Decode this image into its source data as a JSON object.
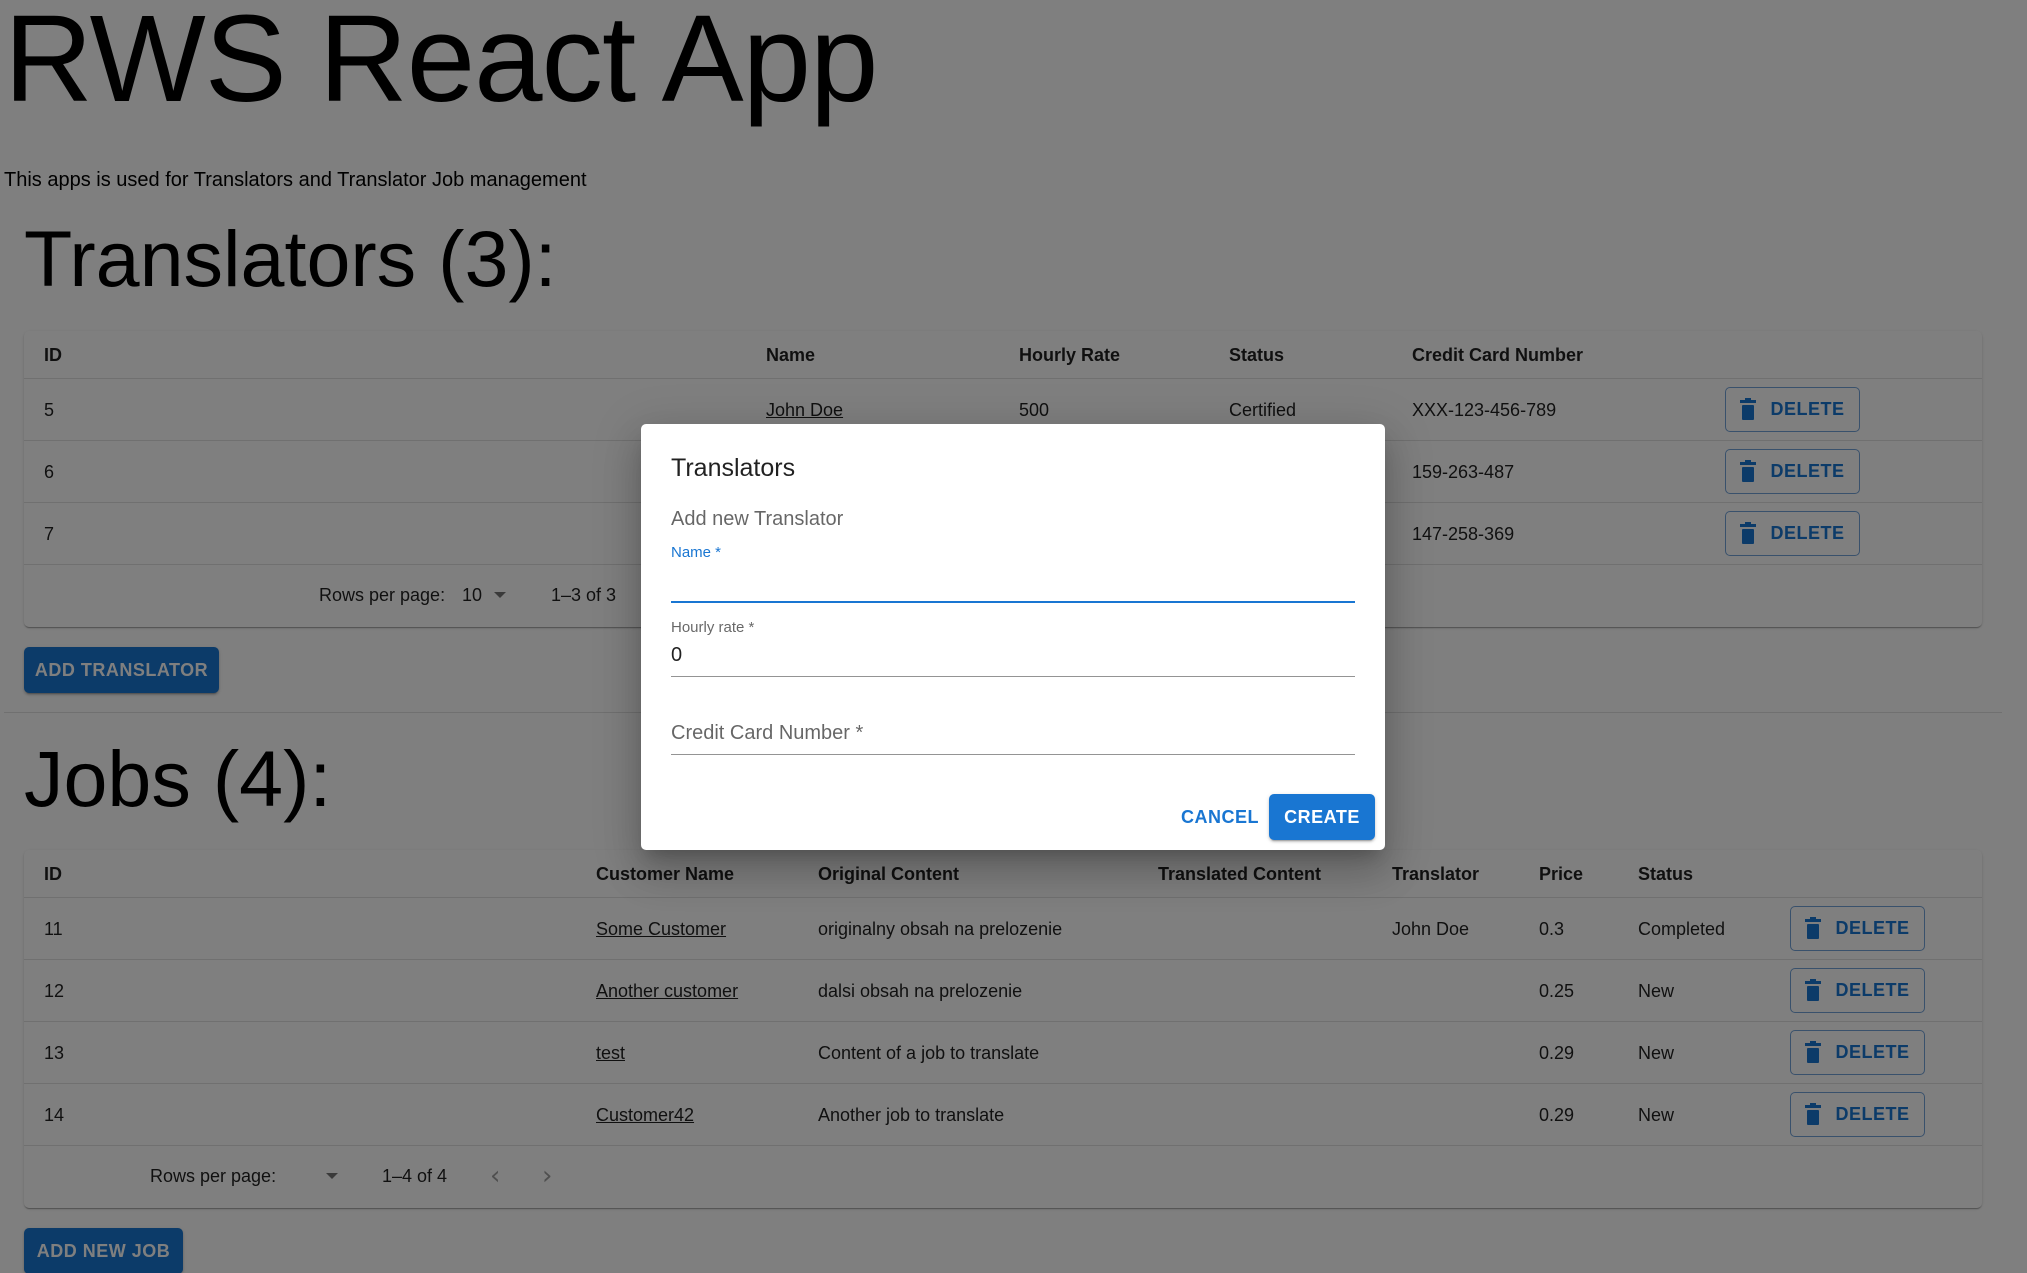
{
  "app": {
    "title": "RWS React App",
    "description": "This apps is used for Translators and Translator Job management"
  },
  "translators": {
    "title": "Translators (3):",
    "columns": [
      "ID",
      "Name",
      "Hourly Rate",
      "Status",
      "Credit Card Number"
    ],
    "rows": [
      {
        "id": "5",
        "name": "John Doe",
        "rate": "500",
        "status": "Certified",
        "card": "XXX-123-456-789",
        "delete": "DELETE"
      },
      {
        "id": "6",
        "name": "",
        "rate": "",
        "status": "",
        "card": "159-263-487",
        "delete": "DELETE"
      },
      {
        "id": "7",
        "name": "",
        "rate": "",
        "status": "",
        "card": "147-258-369",
        "delete": "DELETE"
      }
    ],
    "pagination": {
      "rows_per_page_label": "Rows per page:",
      "rows_per_page": "10",
      "range": "1–3 of 3"
    },
    "add_button": "ADD TRANSLATOR"
  },
  "jobs": {
    "title": "Jobs (4):",
    "columns": [
      "ID",
      "Customer Name",
      "Original Content",
      "Translated Content",
      "Translator",
      "Price",
      "Status"
    ],
    "rows": [
      {
        "id": "11",
        "customer": "Some Customer",
        "original": "originalny obsah na prelozenie",
        "translated": "",
        "translator": "John Doe",
        "price": "0.3",
        "status": "Completed",
        "delete": "DELETE"
      },
      {
        "id": "12",
        "customer": "Another customer",
        "original": "dalsi obsah na prelozenie",
        "translated": "",
        "translator": "",
        "price": "0.25",
        "status": "New",
        "delete": "DELETE"
      },
      {
        "id": "13",
        "customer": "test",
        "original": "Content of a job to translate",
        "translated": "",
        "translator": "",
        "price": "0.29",
        "status": "New",
        "delete": "DELETE"
      },
      {
        "id": "14",
        "customer": "Customer42",
        "original": "Another job to translate",
        "translated": "",
        "translator": "",
        "price": "0.29",
        "status": "New",
        "delete": "DELETE"
      }
    ],
    "pagination": {
      "rows_per_page_label": "Rows per page:",
      "rows_per_page": "",
      "range": "1–4 of 4"
    },
    "add_button": "ADD NEW JOB"
  },
  "dialog": {
    "title": "Translators",
    "subtitle": "Add new Translator",
    "fields": {
      "name": {
        "label": "Name *",
        "value": ""
      },
      "hourly_rate": {
        "label": "Hourly rate *",
        "value": "0"
      },
      "credit_card": {
        "placeholder": "Credit Card Number *",
        "value": ""
      }
    },
    "cancel": "CANCEL",
    "create": "CREATE"
  },
  "colors": {
    "primary": "#1976d2",
    "backdrop": "rgba(0,0,0,0.5)"
  }
}
